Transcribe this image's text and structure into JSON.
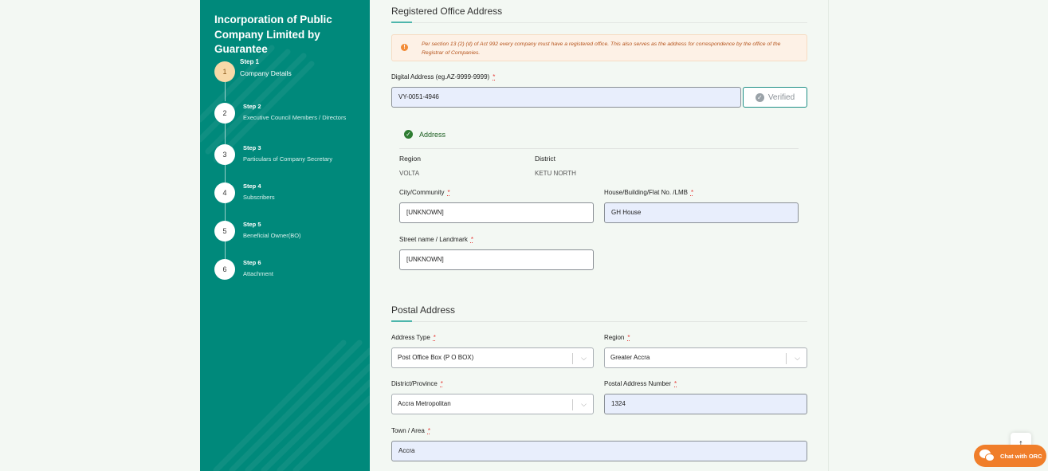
{
  "sidebar": {
    "title": "Incorporation of Public Company Limited by Guarantee",
    "steps": [
      {
        "number": "1",
        "step": "Step 1",
        "label": "Company Details",
        "active": true
      },
      {
        "number": "2",
        "step": "Step 2",
        "label": "Executive Council Members / Directors"
      },
      {
        "number": "3",
        "step": "Step 3",
        "label": "Particulars of Company Secretary"
      },
      {
        "number": "4",
        "step": "Step 4",
        "label": "Subscribers"
      },
      {
        "number": "5",
        "step": "Step 5",
        "label": "Beneficial Owner(BO)"
      },
      {
        "number": "6",
        "step": "Step 6",
        "label": "Attachment"
      }
    ]
  },
  "registered": {
    "title": "Registered Office Address",
    "notice": "Per section 13 (2) (d) of Act 992 every company must have a registered office. This also serves as the address for correspondence by the office of the Registrar of Companies.",
    "digital_label": "Digital Address (eg.AZ-9999-9999)",
    "digital_value": "VY-0051-4946",
    "verified_label": "Verified",
    "address_heading": "Address",
    "region_key": "Region",
    "region_val": "VOLTA",
    "district_key": "District",
    "district_val": "KETU NORTH",
    "city_label": "City/Community",
    "city_value": "[UNKNOWN]",
    "house_label": "House/Building/Flat No. /LMB",
    "house_value": "GH House",
    "street_label": "Street name / Landmark",
    "street_value": "[UNKNOWN]"
  },
  "postal": {
    "title": "Postal Address",
    "type_label": "Address Type",
    "type_value": "Post Office Box (P O BOX)",
    "region_label": "Region",
    "region_value": "Greater Accra",
    "district_label": "District/Province",
    "district_value": "Accra Metropolitan",
    "number_label": "Postal Address Number",
    "number_value": "1324",
    "town_label": "Town / Area",
    "town_value": "Accra"
  },
  "required_mark": "*",
  "chat": {
    "label": "Chat with ORC"
  },
  "icons": {
    "scroll_top": "arrow-up-icon",
    "chat": "chat-bubbles-icon",
    "notice": "exclamation-icon",
    "verified": "check-circle-icon"
  }
}
